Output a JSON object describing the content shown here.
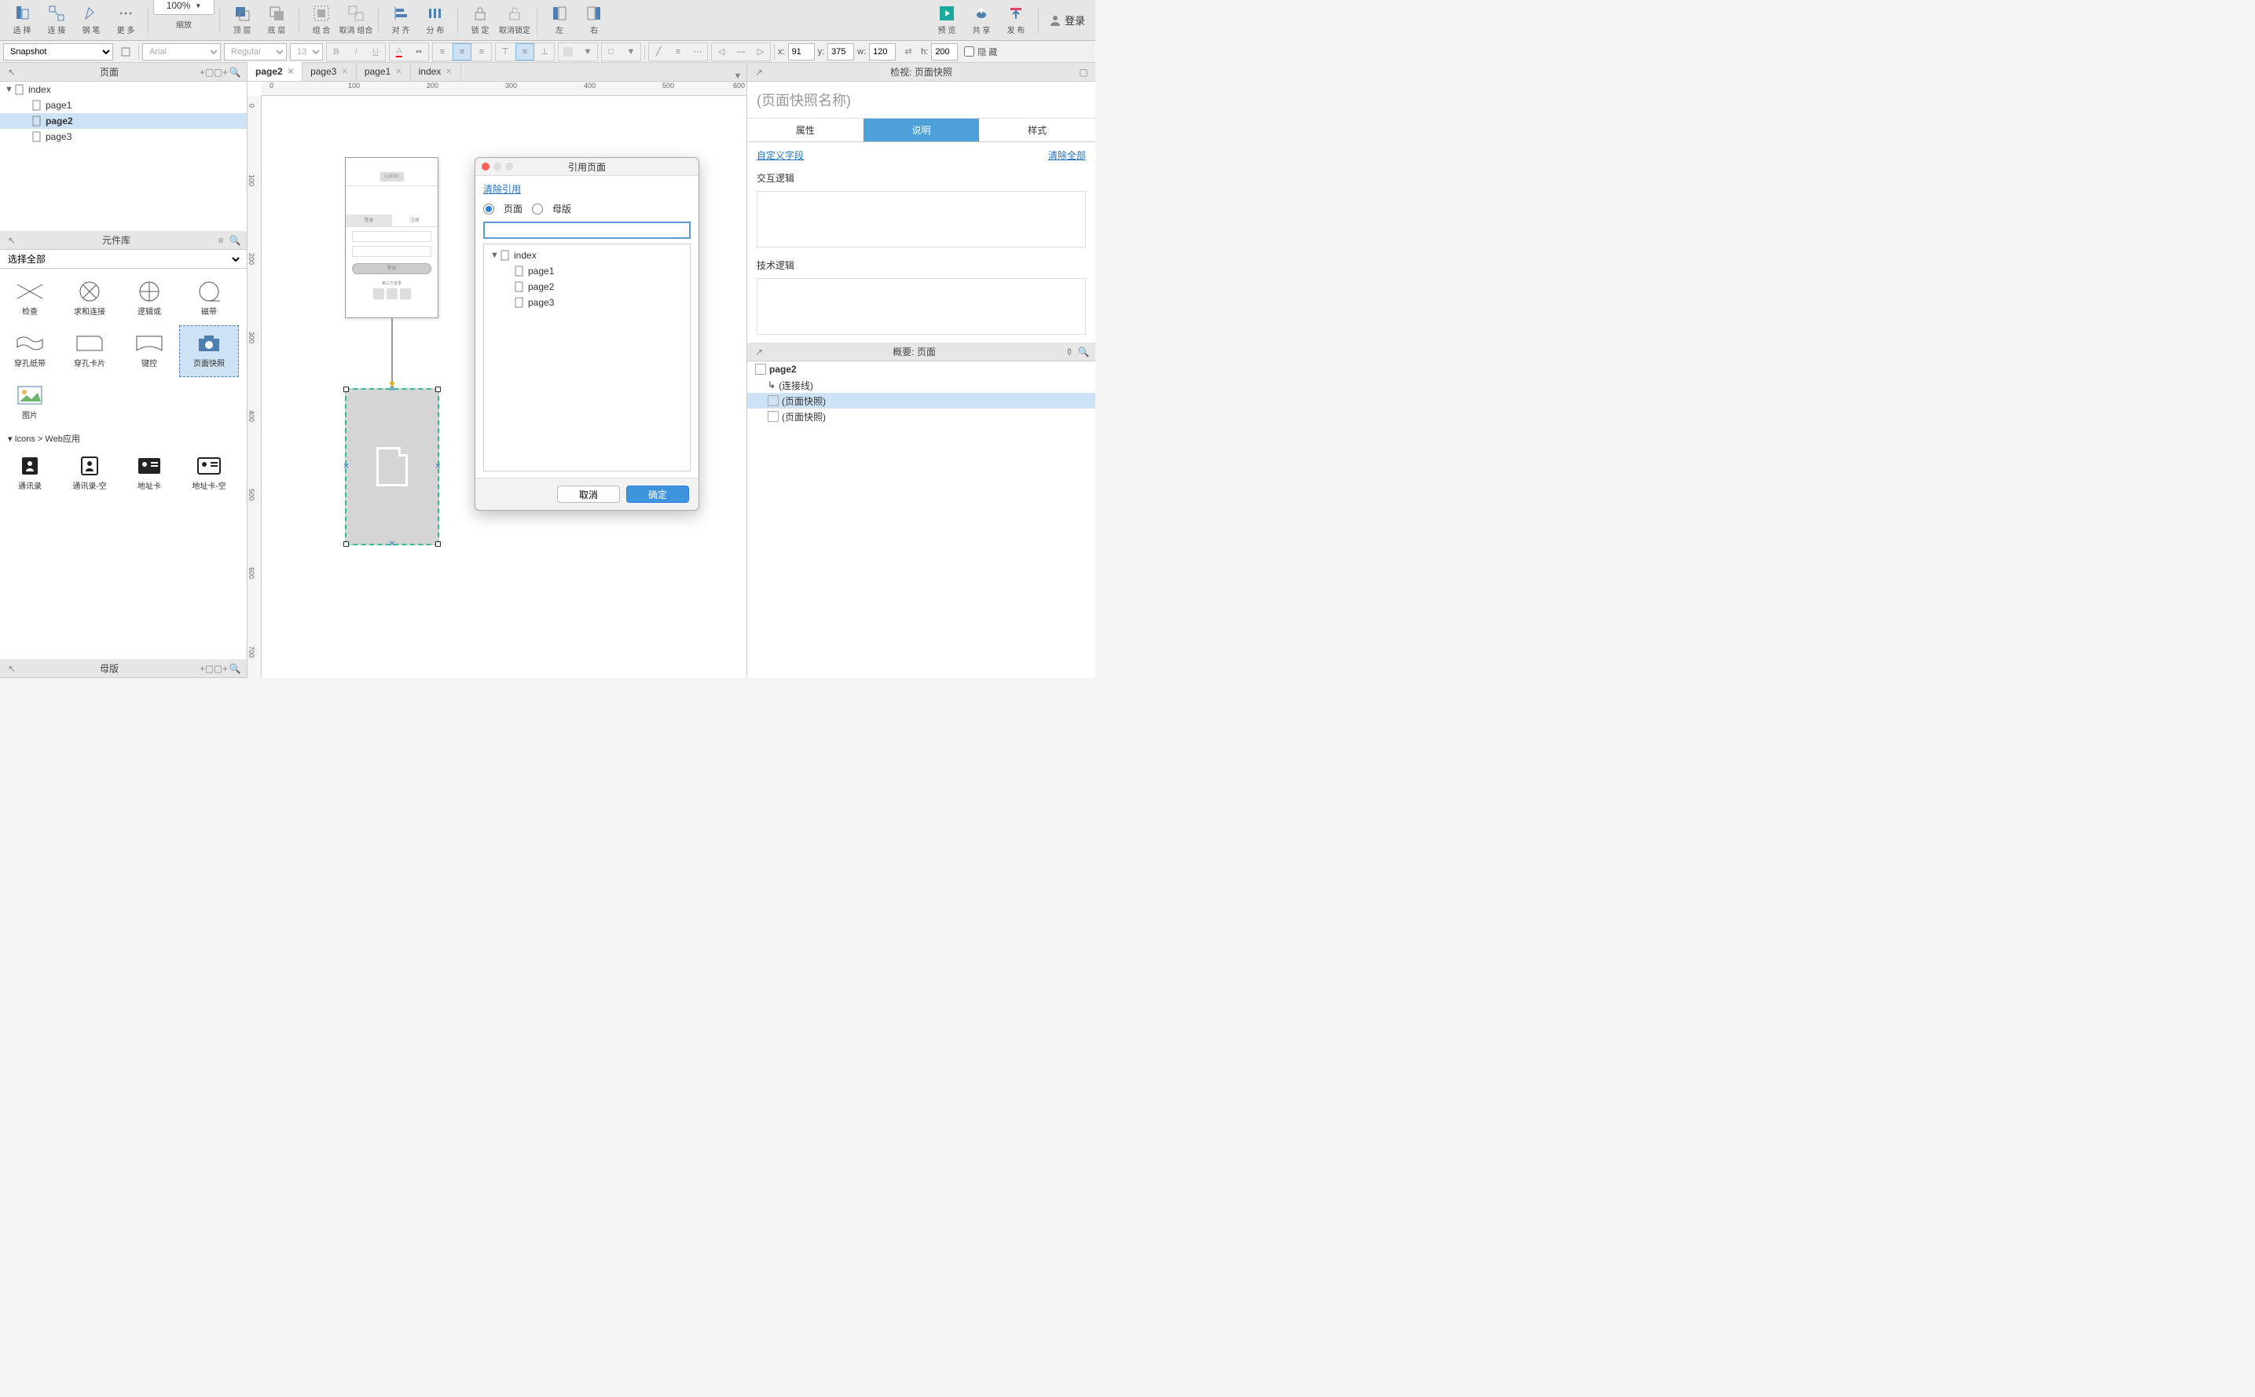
{
  "toolbar": {
    "select": "选 择",
    "connect": "连 接",
    "pen": "钢 笔",
    "more": "更 多",
    "zoom_value": "100%",
    "zoom_label": "缩放",
    "front": "顶 层",
    "back": "底 层",
    "group": "组 合",
    "ungroup": "取消 组合",
    "align": "对 齐",
    "distribute": "分 布",
    "lock": "锁 定",
    "unlock": "取消锁定",
    "left": "左",
    "right": "右",
    "preview": "预 览",
    "share": "共 享",
    "publish": "发 布",
    "login": "登录"
  },
  "sec_toolbar": {
    "widget": "Snapshot",
    "font": "Arial",
    "weight": "Regular",
    "size": "13",
    "x_lbl": "x:",
    "x": "91",
    "y_lbl": "y:",
    "y": "375",
    "w_lbl": "w:",
    "w": "120",
    "h_lbl": "h:",
    "h": "200",
    "hide": "隐 藏"
  },
  "pages": {
    "title": "页面",
    "tree": {
      "root": "index",
      "items": [
        "page1",
        "page2",
        "page3"
      ],
      "selected": "page2"
    }
  },
  "library": {
    "title": "元件库",
    "select_all": "选择全部",
    "row1": [
      "检查",
      "求和连接",
      "逻辑或",
      "磁带"
    ],
    "row2": [
      "穿孔纸带",
      "穿孔卡片",
      "键控",
      "页面快照"
    ],
    "row3": [
      "图片"
    ],
    "cat": "Icons > Web应用",
    "row4": [
      "通讯录",
      "通讯录-空",
      "地址卡",
      "地址卡-空"
    ]
  },
  "masters": {
    "title": "母版"
  },
  "tabs": [
    "page2",
    "page3",
    "page1",
    "index"
  ],
  "inspector": {
    "title": "检视: 页面快照",
    "name": "(页面快照名称)",
    "tabs": [
      "属性",
      "说明",
      "样式"
    ],
    "active_tab": "说明",
    "custom_field": "自定义字段",
    "clear_all": "清除全部",
    "section1": "交互逻辑",
    "section2": "技术逻辑"
  },
  "outline": {
    "title": "概要: 页面",
    "items": [
      "page2",
      "(连接线)",
      "(页面快照)",
      "(页面快照)"
    ]
  },
  "dialog": {
    "title": "引用页面",
    "clear_ref": "清除引用",
    "radio_page": "页面",
    "radio_master": "母版",
    "tree_root": "index",
    "tree_items": [
      "page1",
      "page2",
      "page3"
    ],
    "cancel": "取消",
    "ok": "确定",
    "search": ""
  },
  "artboard": {
    "logo": "LOGO",
    "tab1": "登录",
    "tab2": "注册",
    "btn": "登录",
    "third": "第三方登录"
  },
  "ruler_h": [
    "0",
    "100",
    "200",
    "300",
    "400",
    "500",
    "600"
  ],
  "ruler_v": [
    "0",
    "100",
    "200",
    "300",
    "400",
    "500",
    "600",
    "700"
  ]
}
